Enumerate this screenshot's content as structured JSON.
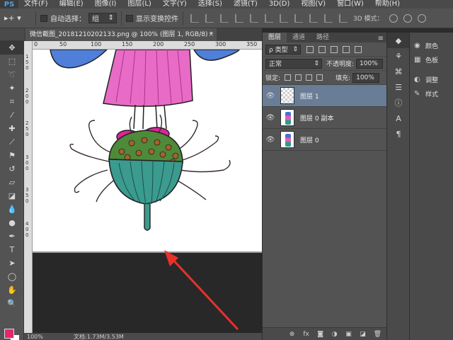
{
  "app": {
    "logo": "PS"
  },
  "menu": [
    "文件(F)",
    "编辑(E)",
    "图像(I)",
    "图层(L)",
    "文字(Y)",
    "选择(S)",
    "滤镜(T)",
    "3D(D)",
    "视图(V)",
    "窗口(W)",
    "帮助(H)"
  ],
  "options": {
    "move_tool_glyph": "▸+ ▾",
    "auto_select_label": "自动选择：",
    "auto_select_value": "组",
    "show_transform_label": "显示变换控件",
    "mode3d_label": "3D 模式："
  },
  "document": {
    "tab_title": "微信截图_20181210202133.png @ 100% (图层 1, RGB/8) *",
    "zoom": "100%",
    "doc_info": "文档:1.73M/3.53M"
  },
  "rulers": {
    "top": [
      "0",
      "50",
      "100",
      "150",
      "200",
      "250",
      "300",
      "350"
    ],
    "left": [
      "1",
      "5",
      "0",
      "2",
      "0",
      "0",
      "2",
      "5",
      "0",
      "3",
      "0",
      "0",
      "3",
      "5",
      "0",
      "4",
      "0",
      "0"
    ]
  },
  "tools": [
    {
      "name": "move-tool",
      "glyph": "✥"
    },
    {
      "name": "marquee-tool",
      "glyph": "⬚"
    },
    {
      "name": "lasso-tool",
      "glyph": "➰"
    },
    {
      "name": "magic-wand-tool",
      "glyph": "✦"
    },
    {
      "name": "crop-tool",
      "glyph": "⌗"
    },
    {
      "name": "eyedropper-tool",
      "glyph": "⁄"
    },
    {
      "name": "healing-tool",
      "glyph": "✚"
    },
    {
      "name": "brush-tool",
      "glyph": "⟋"
    },
    {
      "name": "stamp-tool",
      "glyph": "⚑"
    },
    {
      "name": "history-brush-tool",
      "glyph": "↺"
    },
    {
      "name": "eraser-tool",
      "glyph": "▱"
    },
    {
      "name": "gradient-tool",
      "glyph": "◪"
    },
    {
      "name": "blur-tool",
      "glyph": "💧"
    },
    {
      "name": "dodge-tool",
      "glyph": "●"
    },
    {
      "name": "pen-tool",
      "glyph": "✒"
    },
    {
      "name": "type-tool",
      "glyph": "T"
    },
    {
      "name": "path-select-tool",
      "glyph": "➤"
    },
    {
      "name": "shape-tool",
      "glyph": "◯"
    },
    {
      "name": "hand-tool",
      "glyph": "✋"
    },
    {
      "name": "zoom-tool",
      "glyph": "🔍"
    },
    {
      "name": "extra-tool",
      "glyph": "⋯"
    }
  ],
  "colors": {
    "foreground": "#e1276e",
    "background": "#ffffff",
    "selection": "#697d96",
    "arrow": "#e8312c"
  },
  "layers_panel": {
    "tabs": [
      "图层",
      "通道",
      "路径"
    ],
    "filter_value": "ρ 类型",
    "blend_mode": "正常",
    "opacity_label": "不透明度:",
    "opacity_value": "100%",
    "lock_label": "锁定:",
    "fill_label": "填充:",
    "fill_value": "100%",
    "layers": [
      {
        "name": "图层 1",
        "selected": true,
        "thumb": "transparent"
      },
      {
        "name": "图层 0 副本",
        "selected": false,
        "thumb": "figure"
      },
      {
        "name": "图层 0",
        "selected": false,
        "thumb": "figure"
      }
    ],
    "footer_glyphs": [
      "⊕",
      "fx",
      "◙",
      "◑",
      "▣",
      "◪",
      "🗑"
    ]
  },
  "right_panels": [
    {
      "icon": "◉",
      "label": "颜色"
    },
    {
      "icon": "▦",
      "label": "色板"
    },
    {
      "icon": "◐",
      "label": "调整"
    },
    {
      "icon": "✎",
      "label": "样式"
    }
  ],
  "icon_strip": [
    "◆",
    "⚘",
    "⌘",
    "☰",
    "ⓘ",
    "A",
    "¶"
  ]
}
